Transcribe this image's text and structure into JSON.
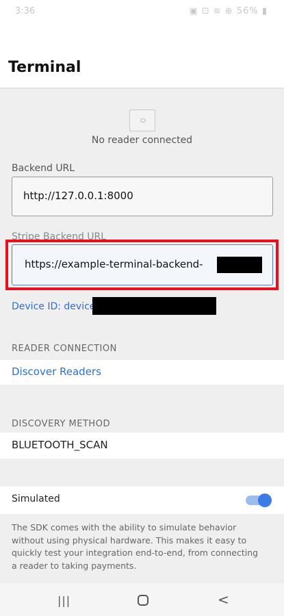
{
  "status_bar": {
    "time": "3:36",
    "icons": "▣ ⊡ ≋ ⊕ 56% ▮"
  },
  "app_bar": {
    "title": "Terminal"
  },
  "reader": {
    "status": "No reader connected"
  },
  "backend_url": {
    "label": "Backend URL",
    "value": "http://127.0.0.1:8000"
  },
  "stripe_backend_url": {
    "label": "Stripe Backend URL",
    "value": "https://example-terminal-backend-"
  },
  "device_id": {
    "text": "Device ID: device_"
  },
  "reader_connection": {
    "header": "READER CONNECTION",
    "discover_label": "Discover Readers"
  },
  "discovery_method": {
    "header": "DISCOVERY METHOD",
    "value": "BLUETOOTH_SCAN"
  },
  "simulated": {
    "label": "Simulated",
    "enabled": true,
    "description": "The SDK comes with the ability to simulate behavior without using physical hardware. This makes it easy to quickly test your integration end-to-end, from connecting a reader to taking payments."
  },
  "colors": {
    "accent": "#2d6fd2",
    "toggle": "#3a7be6",
    "highlight": "#e8101c"
  },
  "nav": {
    "recent": "|||",
    "back": "<"
  }
}
